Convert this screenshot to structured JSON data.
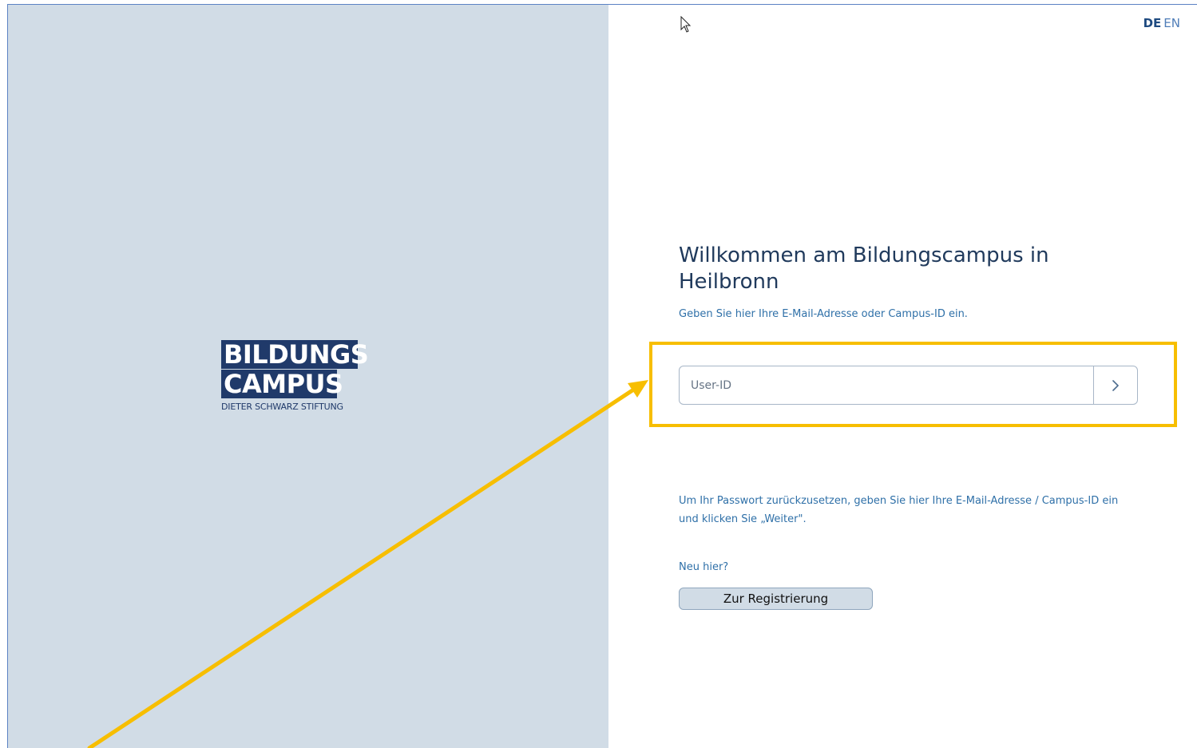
{
  "language": {
    "active": "DE",
    "other": "EN"
  },
  "logo": {
    "line1": "BILDUNGS",
    "line2": "CAMPUS",
    "subtitle": "DIETER SCHWARZ STIFTUNG"
  },
  "login": {
    "title": "Willkommen am Bildungscampus in Heilbronn",
    "instruction": "Geben Sie hier Ihre E-Mail-Adresse oder Campus-ID ein.",
    "input_placeholder": "User-ID",
    "input_value": "",
    "next_icon": "chevron-right-icon",
    "reset_hint": "Um Ihr Passwort zurückzusetzen, geben Sie hier Ihre E-Mail-Adresse / Campus-ID ein und klicken Sie „Weiter\".",
    "new_here": "Neu hier?",
    "register_label": "Zur Registrierung"
  },
  "colors": {
    "left_panel": "#d1dce6",
    "brand_navy": "#203a6a",
    "link_blue": "#2f70a8",
    "annotation_yellow": "#f7be00"
  },
  "annotations": {
    "highlight": "yellow-highlight-box",
    "arrow": "yellow-arrow-annotation"
  }
}
